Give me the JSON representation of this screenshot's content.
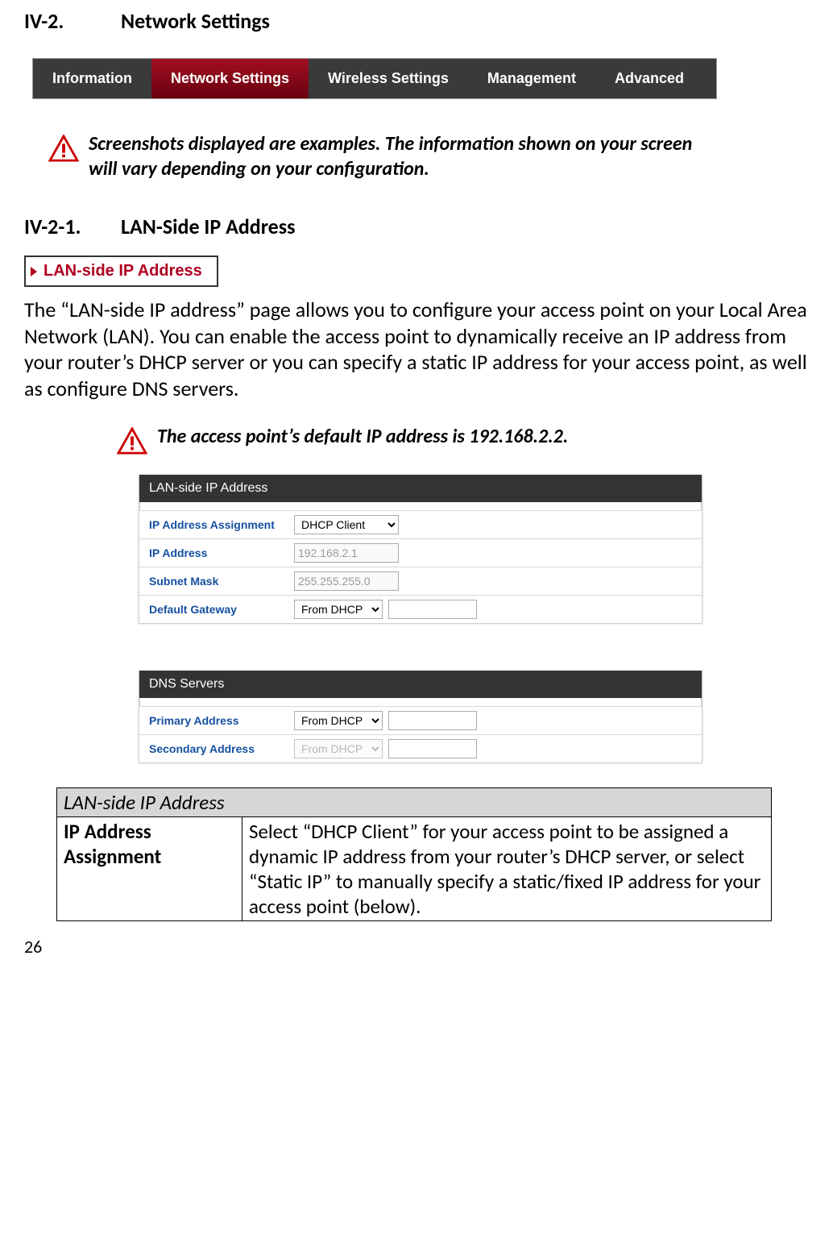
{
  "section": {
    "num": "IV-2.",
    "title": "Network Settings"
  },
  "tabs": {
    "information": "Information",
    "network_settings": "Network Settings",
    "wireless_settings": "Wireless Settings",
    "management": "Management",
    "advanced": "Advanced"
  },
  "note1": "Screenshots displayed are examples. The information shown on your screen will vary depending on your configuration.",
  "subsection": {
    "num": "IV-2-1.",
    "title": "LAN-Side IP Address"
  },
  "menu_chip": "LAN-side IP Address",
  "body_text": "The “LAN-side IP address” page allows you to configure your access point on your Local Area Network (LAN). You can enable the access point to dynamically receive an IP address from your router’s DHCP server or you can specify a static IP address for your access point, as well as configure DNS servers.",
  "note2": "The access point’s default IP address is 192.168.2.2.",
  "panel1": {
    "header": "LAN-side IP Address",
    "rows": {
      "ip_assign_label": "IP Address Assignment",
      "ip_assign_value": "DHCP Client",
      "ip_addr_label": "IP Address",
      "ip_addr_value": "192.168.2.1",
      "subnet_label": "Subnet Mask",
      "subnet_value": "255.255.255.0",
      "gateway_label": "Default Gateway",
      "gateway_value": "From DHCP"
    }
  },
  "panel2": {
    "header": "DNS Servers",
    "rows": {
      "primary_label": "Primary Address",
      "primary_value": "From DHCP",
      "secondary_label": "Secondary Address",
      "secondary_value": "From DHCP"
    }
  },
  "desc_table": {
    "header": "LAN-side IP Address",
    "row1_label": "IP Address Assignment",
    "row1_text": "Select “DHCP Client” for your access point to be assigned a dynamic IP address from your router’s DHCP server, or select “Static IP” to manually specify a static/fixed IP address for your access point (below)."
  },
  "page_number": "26"
}
